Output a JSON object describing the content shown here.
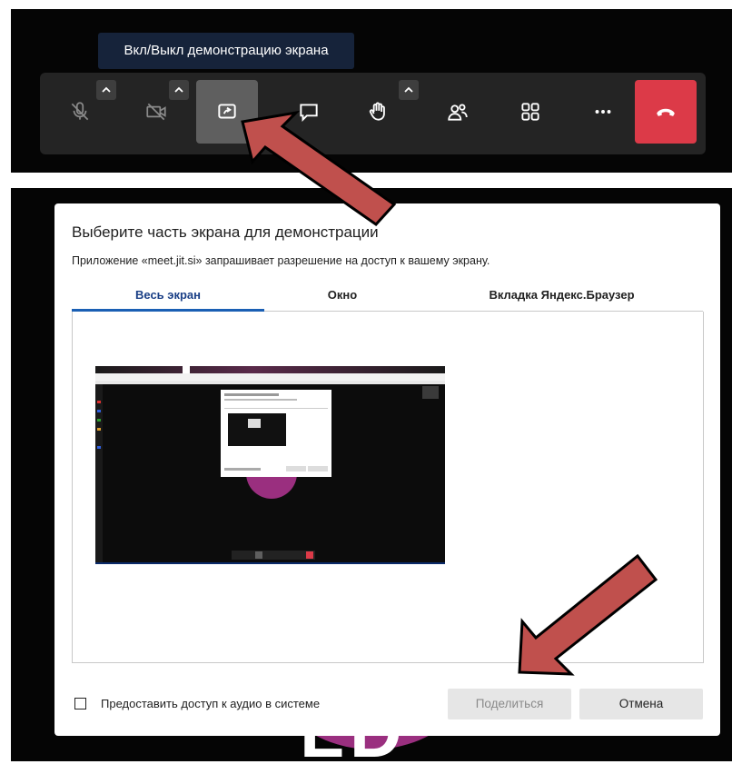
{
  "toolbar": {
    "tooltip": "Вкл/Выкл демонстрацию экрана",
    "buttons": [
      {
        "icon": "mic-off-icon"
      },
      {
        "icon": "camera-off-icon"
      },
      {
        "icon": "screen-share-icon"
      },
      {
        "icon": "chat-icon"
      },
      {
        "icon": "raise-hand-icon"
      },
      {
        "icon": "participants-icon"
      },
      {
        "icon": "tile-view-icon"
      },
      {
        "icon": "more-icon"
      },
      {
        "icon": "hangup-icon"
      }
    ],
    "colors": {
      "active": "#5f5f5f",
      "hangup": "#dc3a48",
      "tooltip_bg": "#16233a"
    }
  },
  "dialog": {
    "title": "Выберите часть экрана для демонстрации",
    "subtitle": "Приложение «meet.jit.si» запрашивает разрешение на доступ к вашему экрану.",
    "tabs": [
      {
        "label": "Весь экран",
        "active": true
      },
      {
        "label": "Окно",
        "active": false
      },
      {
        "label": "Вкладка Яндекс.Браузер",
        "active": false
      }
    ],
    "audio_checkbox_label": "Предоставить доступ к аудио в системе",
    "audio_checkbox_checked": false,
    "share_button": "Поделиться",
    "cancel_button": "Отмена",
    "accent_color": "#1a5fb4"
  },
  "annotation_arrow_color": "#c0504d"
}
